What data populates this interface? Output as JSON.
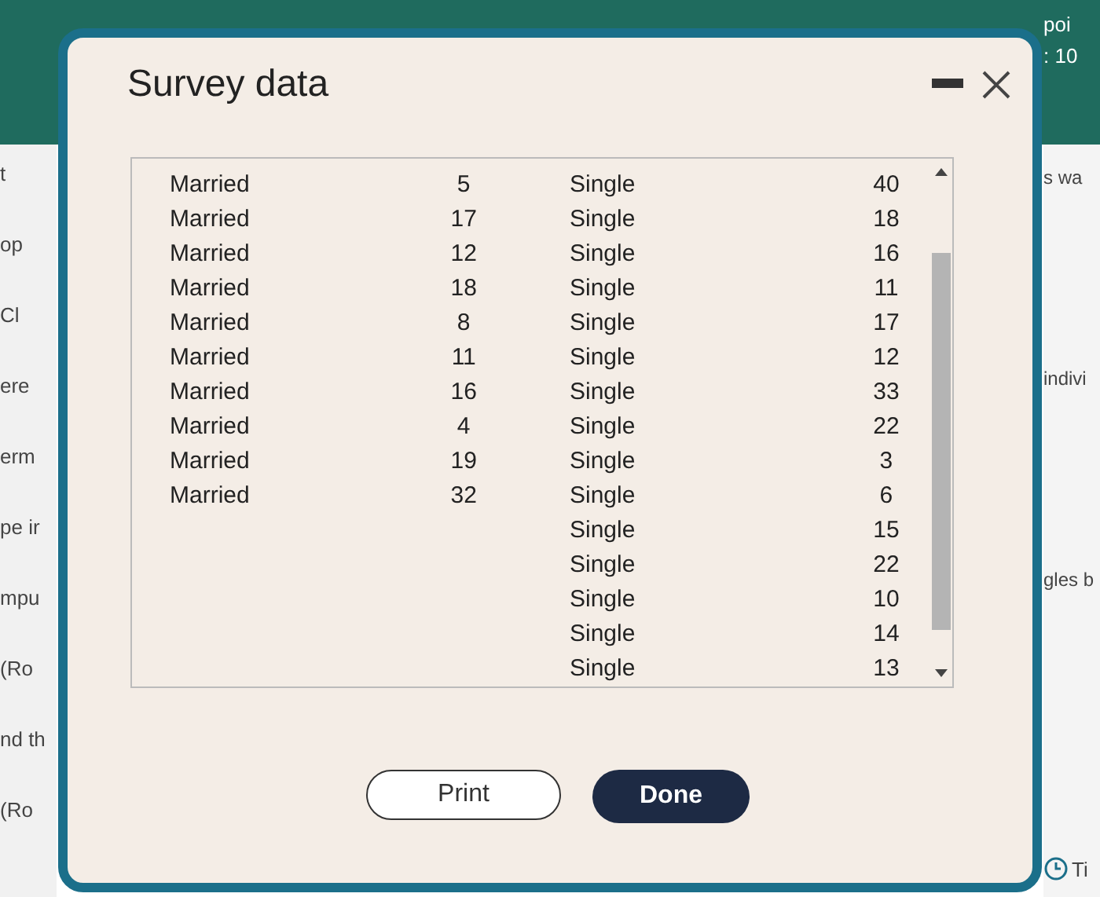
{
  "background_page": {
    "left_fragments": [
      "t",
      "op",
      "Cl",
      "ere",
      "erm",
      "pe ir",
      "mpu",
      "(Ro",
      "nd th",
      "(Ro"
    ],
    "right_header": [
      "poi",
      ": 10"
    ],
    "right_fragments": [
      "s wa",
      "indivi",
      "gles b"
    ],
    "timer_label": "Ti"
  },
  "dialog": {
    "title": "Survey data",
    "table": {
      "rows": [
        {
          "column_1": "Married",
          "column_2": "5",
          "column_3": "Single",
          "column_4": "40"
        },
        {
          "column_1": "Married",
          "column_2": "17",
          "column_3": "Single",
          "column_4": "18"
        },
        {
          "column_1": "Married",
          "column_2": "12",
          "column_3": "Single",
          "column_4": "16"
        },
        {
          "column_1": "Married",
          "column_2": "18",
          "column_3": "Single",
          "column_4": "11"
        },
        {
          "column_1": "Married",
          "column_2": "8",
          "column_3": "Single",
          "column_4": "17"
        },
        {
          "column_1": "Married",
          "column_2": "11",
          "column_3": "Single",
          "column_4": "12"
        },
        {
          "column_1": "Married",
          "column_2": "16",
          "column_3": "Single",
          "column_4": "33"
        },
        {
          "column_1": "Married",
          "column_2": "4",
          "column_3": "Single",
          "column_4": "22"
        },
        {
          "column_1": "Married",
          "column_2": "19",
          "column_3": "Single",
          "column_4": "3"
        },
        {
          "column_1": "Married",
          "column_2": "32",
          "column_3": "Single",
          "column_4": "6"
        },
        {
          "column_3": "Single",
          "column_4": "15"
        },
        {
          "column_3": "Single",
          "column_4": "22"
        },
        {
          "column_3": "Single",
          "column_4": "10"
        },
        {
          "column_3": "Single",
          "column_4": "14"
        },
        {
          "column_3": "Single",
          "column_4": "13"
        }
      ]
    },
    "buttons": [
      {
        "label": "Print",
        "kind": "secondary"
      },
      {
        "label": "Done",
        "kind": "primary"
      }
    ]
  }
}
